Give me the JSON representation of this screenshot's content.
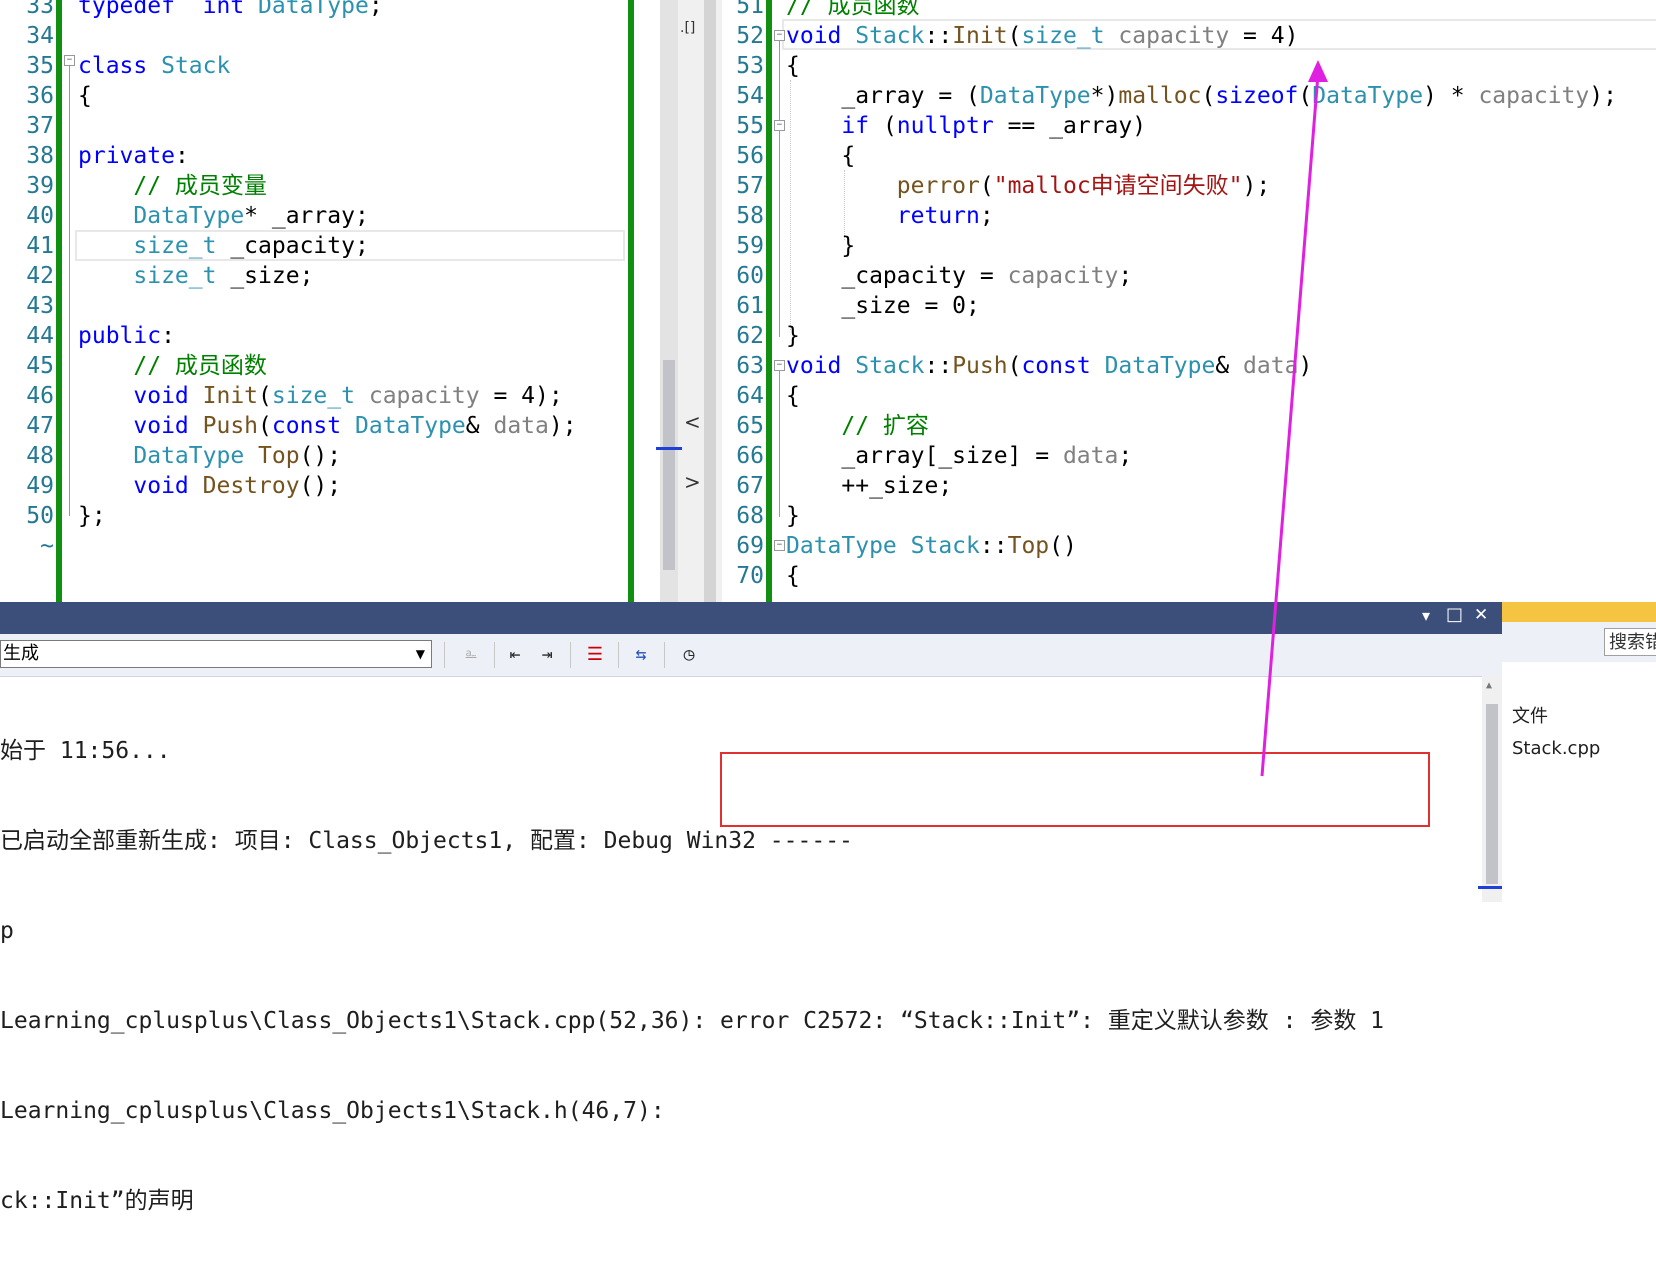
{
  "left_editor": {
    "lines": [
      {
        "n": "33",
        "segs": [
          [
            "kw",
            "typedef"
          ],
          [
            "",
            "  "
          ],
          [
            "kw",
            "int"
          ],
          [
            "",
            " "
          ],
          [
            "ty",
            "DataType"
          ],
          [
            "",
            ";"
          ]
        ]
      },
      {
        "n": "34",
        "segs": []
      },
      {
        "n": "35",
        "segs": [
          [
            "kw",
            "class"
          ],
          [
            "",
            " "
          ],
          [
            "ty",
            "Stack"
          ]
        ]
      },
      {
        "n": "36",
        "segs": [
          [
            "",
            "{"
          ]
        ]
      },
      {
        "n": "37",
        "segs": []
      },
      {
        "n": "38",
        "segs": [
          [
            "kw",
            "private"
          ],
          [
            "",
            ":"
          ]
        ]
      },
      {
        "n": "39",
        "segs": [
          [
            "",
            "    "
          ],
          [
            "cm",
            "// 成员变量"
          ]
        ]
      },
      {
        "n": "40",
        "segs": [
          [
            "",
            "    "
          ],
          [
            "ty",
            "DataType"
          ],
          [
            "",
            "* _array;"
          ]
        ]
      },
      {
        "n": "41",
        "segs": [
          [
            "",
            "    "
          ],
          [
            "ty",
            "size_t"
          ],
          [
            "",
            " _capacity;"
          ]
        ]
      },
      {
        "n": "42",
        "segs": [
          [
            "",
            "    "
          ],
          [
            "ty",
            "size_t"
          ],
          [
            "",
            " _size;"
          ]
        ]
      },
      {
        "n": "43",
        "segs": []
      },
      {
        "n": "44",
        "segs": [
          [
            "kw",
            "public"
          ],
          [
            "",
            ":"
          ]
        ]
      },
      {
        "n": "45",
        "segs": [
          [
            "",
            "    "
          ],
          [
            "cm",
            "// 成员函数"
          ]
        ]
      },
      {
        "n": "46",
        "segs": [
          [
            "",
            "    "
          ],
          [
            "kw",
            "void"
          ],
          [
            "",
            " "
          ],
          [
            "fn",
            "Init"
          ],
          [
            "",
            "("
          ],
          [
            "ty",
            "size_t"
          ],
          [
            "",
            " "
          ],
          [
            "pm",
            "capacity"
          ],
          [
            "",
            " = 4);"
          ]
        ]
      },
      {
        "n": "47",
        "segs": [
          [
            "",
            "    "
          ],
          [
            "kw",
            "void"
          ],
          [
            "",
            " "
          ],
          [
            "fn",
            "Push"
          ],
          [
            "",
            "("
          ],
          [
            "kw",
            "const"
          ],
          [
            "",
            " "
          ],
          [
            "ty",
            "DataType"
          ],
          [
            "",
            "& "
          ],
          [
            "pm",
            "data"
          ],
          [
            "",
            ");"
          ]
        ]
      },
      {
        "n": "48",
        "segs": [
          [
            "",
            "    "
          ],
          [
            "ty",
            "DataType"
          ],
          [
            "",
            " "
          ],
          [
            "fn",
            "Top"
          ],
          [
            "",
            "();"
          ]
        ]
      },
      {
        "n": "49",
        "segs": [
          [
            "",
            "    "
          ],
          [
            "kw",
            "void"
          ],
          [
            "",
            " "
          ],
          [
            "fn",
            "Destroy"
          ],
          [
            "",
            "();"
          ]
        ]
      },
      {
        "n": "50",
        "segs": [
          [
            "",
            "};"
          ]
        ]
      },
      {
        "n": "~",
        "segs": []
      }
    ]
  },
  "right_editor": {
    "lines": [
      {
        "n": "51",
        "segs": [
          [
            "cm",
            "// 成员函数"
          ]
        ]
      },
      {
        "n": "52",
        "segs": [
          [
            "kw",
            "void"
          ],
          [
            "",
            " "
          ],
          [
            "ty",
            "Stack"
          ],
          [
            "",
            "::"
          ],
          [
            "fn",
            "Init"
          ],
          [
            "",
            "("
          ],
          [
            "ty",
            "size_t"
          ],
          [
            "",
            " "
          ],
          [
            "pm",
            "capacity"
          ],
          [
            "",
            " = 4)"
          ]
        ]
      },
      {
        "n": "53",
        "segs": [
          [
            "",
            "{"
          ]
        ]
      },
      {
        "n": "54",
        "segs": [
          [
            "",
            "    _array = ("
          ],
          [
            "ty",
            "DataType"
          ],
          [
            "",
            "*)"
          ],
          [
            "fn",
            "malloc"
          ],
          [
            "",
            "("
          ],
          [
            "kw",
            "sizeof"
          ],
          [
            "",
            "("
          ],
          [
            "ty",
            "DataType"
          ],
          [
            "",
            ") * "
          ],
          [
            "pm",
            "capacity"
          ],
          [
            "",
            ");"
          ]
        ]
      },
      {
        "n": "55",
        "segs": [
          [
            "",
            "    "
          ],
          [
            "kw",
            "if"
          ],
          [
            "",
            " ("
          ],
          [
            "kw",
            "nullptr"
          ],
          [
            "",
            " == _array)"
          ]
        ]
      },
      {
        "n": "56",
        "segs": [
          [
            "",
            "    {"
          ]
        ]
      },
      {
        "n": "57",
        "segs": [
          [
            "",
            "        "
          ],
          [
            "fn",
            "perror"
          ],
          [
            "",
            "("
          ],
          [
            "st",
            "\"malloc申请空间失败\""
          ],
          [
            "",
            ");"
          ]
        ]
      },
      {
        "n": "58",
        "segs": [
          [
            "",
            "        "
          ],
          [
            "kw",
            "return"
          ],
          [
            "",
            ";"
          ]
        ]
      },
      {
        "n": "59",
        "segs": [
          [
            "",
            "    }"
          ]
        ]
      },
      {
        "n": "60",
        "segs": [
          [
            "",
            "    _capacity = "
          ],
          [
            "pm",
            "capacity"
          ],
          [
            "",
            ";"
          ]
        ]
      },
      {
        "n": "61",
        "segs": [
          [
            "",
            "    _size = 0;"
          ]
        ]
      },
      {
        "n": "62",
        "segs": [
          [
            "",
            "}"
          ]
        ]
      },
      {
        "n": "63",
        "segs": [
          [
            "kw",
            "void"
          ],
          [
            "",
            " "
          ],
          [
            "ty",
            "Stack"
          ],
          [
            "",
            "::"
          ],
          [
            "fn",
            "Push"
          ],
          [
            "",
            "("
          ],
          [
            "kw",
            "const"
          ],
          [
            "",
            " "
          ],
          [
            "ty",
            "DataType"
          ],
          [
            "",
            "& "
          ],
          [
            "pm",
            "data"
          ],
          [
            "",
            ")"
          ]
        ]
      },
      {
        "n": "64",
        "segs": [
          [
            "",
            "{"
          ]
        ]
      },
      {
        "n": "65",
        "segs": [
          [
            "",
            "    "
          ],
          [
            "cm",
            "// 扩容"
          ]
        ]
      },
      {
        "n": "66",
        "segs": [
          [
            "",
            "    _array[_size] = "
          ],
          [
            "pm",
            "data"
          ],
          [
            "",
            ";"
          ]
        ]
      },
      {
        "n": "67",
        "segs": [
          [
            "",
            "    ++_size;"
          ]
        ]
      },
      {
        "n": "68",
        "segs": [
          [
            "",
            "}"
          ]
        ]
      },
      {
        "n": "69",
        "segs": [
          [
            "ty",
            "DataType"
          ],
          [
            "",
            " "
          ],
          [
            "ty",
            "Stack"
          ],
          [
            "",
            "::"
          ],
          [
            "fn",
            "Top"
          ],
          [
            "",
            "()"
          ]
        ]
      },
      {
        "n": "70",
        "segs": [
          [
            "",
            "{"
          ]
        ]
      }
    ]
  },
  "splitter": {
    "top_glyph": ".[]",
    "left_arrow": "<",
    "right_arrow": ">"
  },
  "output": {
    "title_buttons": {
      "dropdown": "▾",
      "maximize": "□",
      "close": "✕"
    },
    "source_value": "生成",
    "lines": [
      "始于 11:56...",
      "已启动全部重新生成: 项目: Class_Objects1, 配置: Debug Win32 ------",
      "p",
      "Learning_cplusplus\\Class_Objects1\\Stack.cpp(52,36): error C2572: “Stack::Init”: 重定义默认参数 : 参数 1",
      "Learning_cplusplus\\Class_Objects1\\Stack.h(46,7):",
      "ck::Init”的声明"
    ]
  },
  "side_panel": {
    "search_placeholder": "搜索错",
    "column_header": "文件",
    "file": "Stack.cpp"
  },
  "colors": {
    "keyword": "#0000ff",
    "type": "#2b91af",
    "comment": "#008000",
    "string": "#a31515",
    "change_bar": "#108f10",
    "annotation_arrow": "#e020e0",
    "error_box": "#e03030"
  }
}
